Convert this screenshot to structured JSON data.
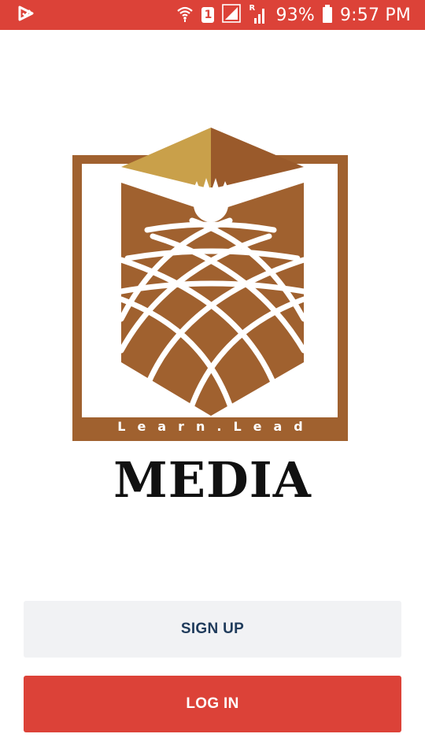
{
  "status_bar": {
    "sim_slot": "1",
    "roaming_indicator": "R",
    "battery": "93%",
    "time": "9:57 PM",
    "icons": [
      "app-notification-icon",
      "wifi-icon",
      "sim-badge",
      "signal-icon",
      "roaming-signal-icon",
      "battery-icon"
    ]
  },
  "logo": {
    "tagline": "Learn.Lead",
    "colors": {
      "brown": "#a0612f",
      "gold": "#c9a04a",
      "white": "#ffffff"
    }
  },
  "brand": {
    "name": "MEDIA"
  },
  "actions": {
    "signup_label": "SIGN UP",
    "login_label": "LOG IN"
  },
  "theme": {
    "accent": "#dc4238",
    "signup_bg": "#f1f2f4",
    "signup_text": "#1f3b5b"
  }
}
